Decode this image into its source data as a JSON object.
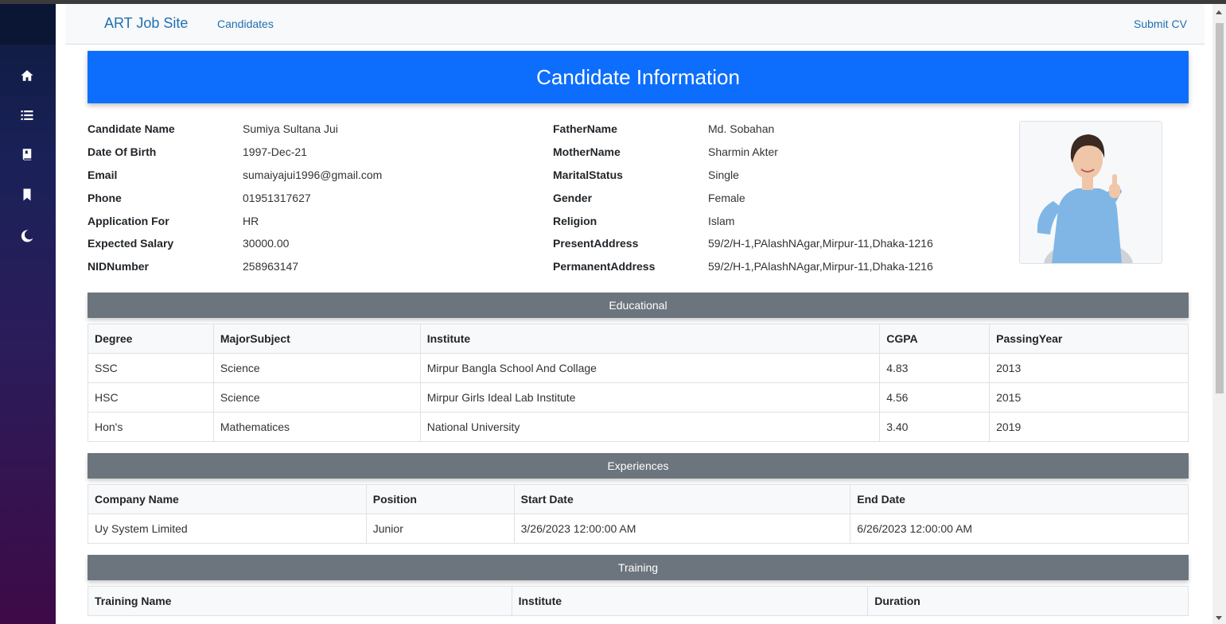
{
  "colors": {
    "primary": "#0d6efd",
    "secondary": "#6c757d",
    "link": "#1f6fb2"
  },
  "sidebar": {
    "icons": [
      "home-icon",
      "list-icon",
      "book-icon",
      "bookmark-icon",
      "moon-icon"
    ]
  },
  "navbar": {
    "brand": "ART Job Site",
    "candidates_link": "Candidates",
    "submit_cv_link": "Submit CV"
  },
  "header": {
    "title": "Candidate Information"
  },
  "candidate": {
    "left": [
      {
        "label": "Candidate Name",
        "value": "Sumiya Sultana Jui"
      },
      {
        "label": "Date Of Birth",
        "value": "1997-Dec-21"
      },
      {
        "label": "Email",
        "value": "sumaiyajui1996@gmail.com"
      },
      {
        "label": "Phone",
        "value": "01951317627"
      },
      {
        "label": "Application For",
        "value": "HR"
      },
      {
        "label": "Expected Salary",
        "value": "30000.00"
      },
      {
        "label": "NIDNumber",
        "value": "258963147"
      }
    ],
    "right": [
      {
        "label": "FatherName",
        "value": "Md. Sobahan"
      },
      {
        "label": "MotherName",
        "value": "Sharmin Akter"
      },
      {
        "label": "MaritalStatus",
        "value": "Single"
      },
      {
        "label": "Gender",
        "value": "Female"
      },
      {
        "label": "Religion",
        "value": "Islam"
      },
      {
        "label": "PresentAddress",
        "value": "59/2/H-1,PAlashNAgar,Mirpur-11,Dhaka-1216"
      },
      {
        "label": "PermanentAddress",
        "value": "59/2/H-1,PAlashNAgar,Mirpur-11,Dhaka-1216"
      }
    ]
  },
  "educational": {
    "title": "Educational",
    "headers": [
      "Degree",
      "MajorSubject",
      "Institute",
      "CGPA",
      "PassingYear"
    ],
    "rows": [
      [
        "SSC",
        "Science",
        "Mirpur Bangla School And Collage",
        "4.83",
        "2013"
      ],
      [
        "HSC",
        "Science",
        "Mirpur Girls Ideal Lab Institute",
        "4.56",
        "2015"
      ],
      [
        "Hon's",
        "Mathematices",
        "National University",
        "3.40",
        "2019"
      ]
    ]
  },
  "experiences": {
    "title": "Experiences",
    "headers": [
      "Company Name",
      "Position",
      "Start Date",
      "End Date"
    ],
    "rows": [
      [
        "Uy System Limited",
        "Junior",
        "3/26/2023 12:00:00 AM",
        "6/26/2023 12:00:00 AM"
      ]
    ]
  },
  "training": {
    "title": "Training",
    "headers": [
      "Training Name",
      "Institute",
      "Duration"
    ]
  }
}
